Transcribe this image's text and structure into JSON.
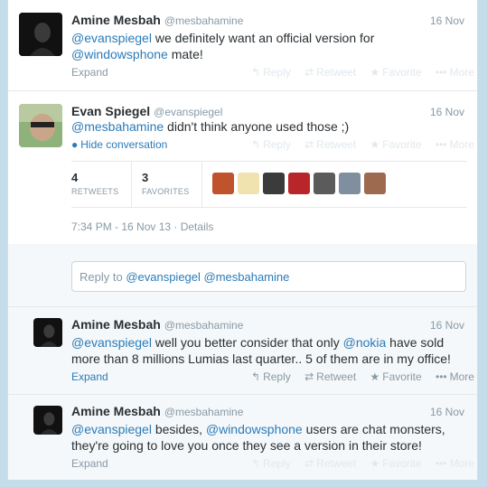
{
  "tweets": [
    {
      "name": "Amine Mesbah",
      "handle": "@mesbahamine",
      "time": "16 Nov",
      "text_parts": [
        "@evanspiegel",
        " we definitely want an official version for ",
        "@windowsphone",
        " mate!"
      ],
      "expand": "Expand"
    },
    {
      "name": "Evan Spiegel",
      "handle": "@evanspiegel",
      "time": "16 Nov",
      "text_parts": [
        "@mesbahamine",
        " didn't think anyone used those ;)"
      ],
      "hide_conversation": "Hide conversation",
      "retweets_count": "4",
      "retweets_label": "RETWEETS",
      "favorites_count": "3",
      "favorites_label": "FAVORITES",
      "details": "7:34 PM - 16 Nov 13 · Details"
    },
    {
      "name": "Amine Mesbah",
      "handle": "@mesbahamine",
      "time": "16 Nov",
      "text_parts": [
        "@evanspiegel",
        " well you better consider that only ",
        "@nokia",
        " have sold more than 8 millions Lumias last quarter.. 5 of them are in my office!"
      ],
      "expand": "Expand"
    },
    {
      "name": "Amine Mesbah",
      "handle": "@mesbahamine",
      "time": "16 Nov",
      "text_parts": [
        "@evanspiegel",
        " besides, ",
        "@windowsphone",
        " users are chat monsters, they're going to love you once they see a version in their store!"
      ],
      "expand": "Expand"
    }
  ],
  "actions": {
    "reply": "Reply",
    "retweet": "Retweet",
    "favorite": "Favorite",
    "more": "More"
  },
  "reply_box": {
    "prefix": "Reply to ",
    "mentions": "@evanspiegel @mesbahamine"
  },
  "colors": {
    "link": "#2b7bb9",
    "muted": "#8899a6",
    "faded": "#e1e8ed",
    "background": "#c5dcea"
  }
}
